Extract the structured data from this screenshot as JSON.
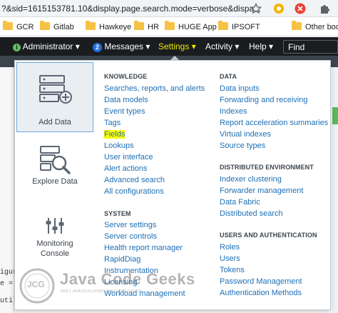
{
  "browser": {
    "url": "?&sid=1615153781.10&display.page.search.mode=verbose&dispa...",
    "icons": [
      "star-icon",
      "extension-icon",
      "close-icon",
      "puzzle-icon"
    ],
    "bookmarks": [
      {
        "label": "GCR"
      },
      {
        "label": "Gitlab"
      },
      {
        "label": "Hawkeye"
      },
      {
        "label": "HR"
      },
      {
        "label": "HUGE App"
      },
      {
        "label": "IPSOFT"
      },
      {
        "label": "Other bool"
      }
    ]
  },
  "navbar": {
    "administrator": "Administrator ▾",
    "messages_count": "2",
    "messages": "Messages ▾",
    "settings": "Settings ▾",
    "activity": "Activity ▾",
    "help": "Help ▾",
    "find_placeholder": "Find"
  },
  "background": {
    "snippet1": "igura",
    "snippet2": "e = K",
    "snippet3": "util"
  },
  "tiles": [
    {
      "label": "Add Data",
      "icon": "add-data-icon"
    },
    {
      "label": "Explore Data",
      "icon": "explore-data-icon"
    },
    {
      "label": "Monitoring Console",
      "label_line1": "Monitoring",
      "label_line2": "Console",
      "icon": "sliders-icon"
    }
  ],
  "knowledge": {
    "heading": "KNOWLEDGE",
    "items": [
      "Searches, reports, and alerts",
      "Data models",
      "Event types",
      "Tags",
      "Fields",
      "Lookups",
      "User interface",
      "Alert actions",
      "Advanced search",
      "All configurations"
    ]
  },
  "system": {
    "heading": "SYSTEM",
    "items": [
      "Server settings",
      "Server controls",
      "Health report manager",
      "RapidDiag",
      "Instrumentation",
      "Licensing",
      "Workload management"
    ]
  },
  "data": {
    "heading": "DATA",
    "items": [
      "Data inputs",
      "Forwarding and receiving",
      "Indexes",
      "Report acceleration summaries",
      "Virtual indexes",
      "Source types"
    ]
  },
  "distributed": {
    "heading": "DISTRIBUTED ENVIRONMENT",
    "items": [
      "Indexer clustering",
      "Forwarder management",
      "Data Fabric",
      "Distributed search"
    ]
  },
  "users": {
    "heading": "USERS AND AUTHENTICATION",
    "items": [
      "Roles",
      "Users",
      "Tokens",
      "Password Management",
      "Authentication Methods"
    ]
  },
  "watermark": {
    "logo_text": "JCG",
    "brand": "Java Code Geeks",
    "tagline": "JAVA 2 JAVA DEVELOPERS RESOURCE CENTER"
  },
  "colors": {
    "nav_bg": "#1a1c20",
    "active_nav": "#e8e800",
    "link": "#1e6fb5",
    "highlight": "#ffff00",
    "badge": "#1e6fd9"
  }
}
